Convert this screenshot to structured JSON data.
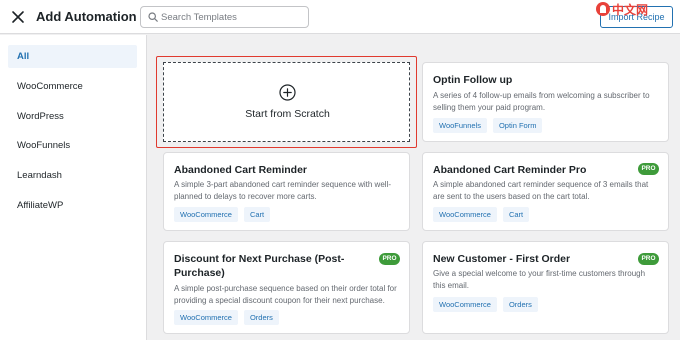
{
  "header": {
    "title": "Add Automation",
    "search_placeholder": "Search Templates",
    "top_right_button": "Import Recipe",
    "watermark": "中文网"
  },
  "sidebar": {
    "items": [
      {
        "label": "All",
        "active": true
      },
      {
        "label": "WooCommerce"
      },
      {
        "label": "WordPress"
      },
      {
        "label": "WooFunnels"
      },
      {
        "label": "Learndash"
      },
      {
        "label": "AffiliateWP"
      }
    ]
  },
  "scratch": {
    "label": "Start from Scratch",
    "icon": "plus-circle-icon"
  },
  "cards": [
    {
      "title": "Optin Follow up",
      "desc": [
        "A series of 4 follow-up emails from welcoming a subscriber to",
        "selling them your paid program."
      ],
      "tags": [
        "WooFunnels",
        "Optin Form"
      ],
      "pro": false
    },
    {
      "title": "Abandoned Cart Reminder",
      "desc": [
        "A simple 3-part abandoned cart reminder sequence with well-",
        "planned to delays to recover more carts."
      ],
      "tags": [
        "WooCommerce",
        "Cart"
      ],
      "pro": false
    },
    {
      "title": "Abandoned Cart Reminder Pro",
      "desc": [
        "A simple abandoned cart reminder sequence of 3 emails that",
        "are sent to the users based on the cart total."
      ],
      "tags": [
        "WooCommerce",
        "Cart"
      ],
      "pro": true
    },
    {
      "title": [
        "Discount for Next Purchase (Post-",
        "Purchase)"
      ],
      "desc": [
        "A simple post-purchase sequence based on their order total for",
        "providing a special discount coupon for their next purchase."
      ],
      "tags": [
        "WooCommerce",
        "Orders"
      ],
      "pro": true
    },
    {
      "title": "New Customer - First Order",
      "desc": [
        "Give a special welcome to your first-time customers through",
        "this email."
      ],
      "tags": [
        "WooCommerce",
        "Orders"
      ],
      "pro": true
    }
  ],
  "pro_label": "PRO",
  "colors": {
    "accent": "#2271b1",
    "pro_badge": "#3e9b3a",
    "highlight": "#e03a2f"
  }
}
